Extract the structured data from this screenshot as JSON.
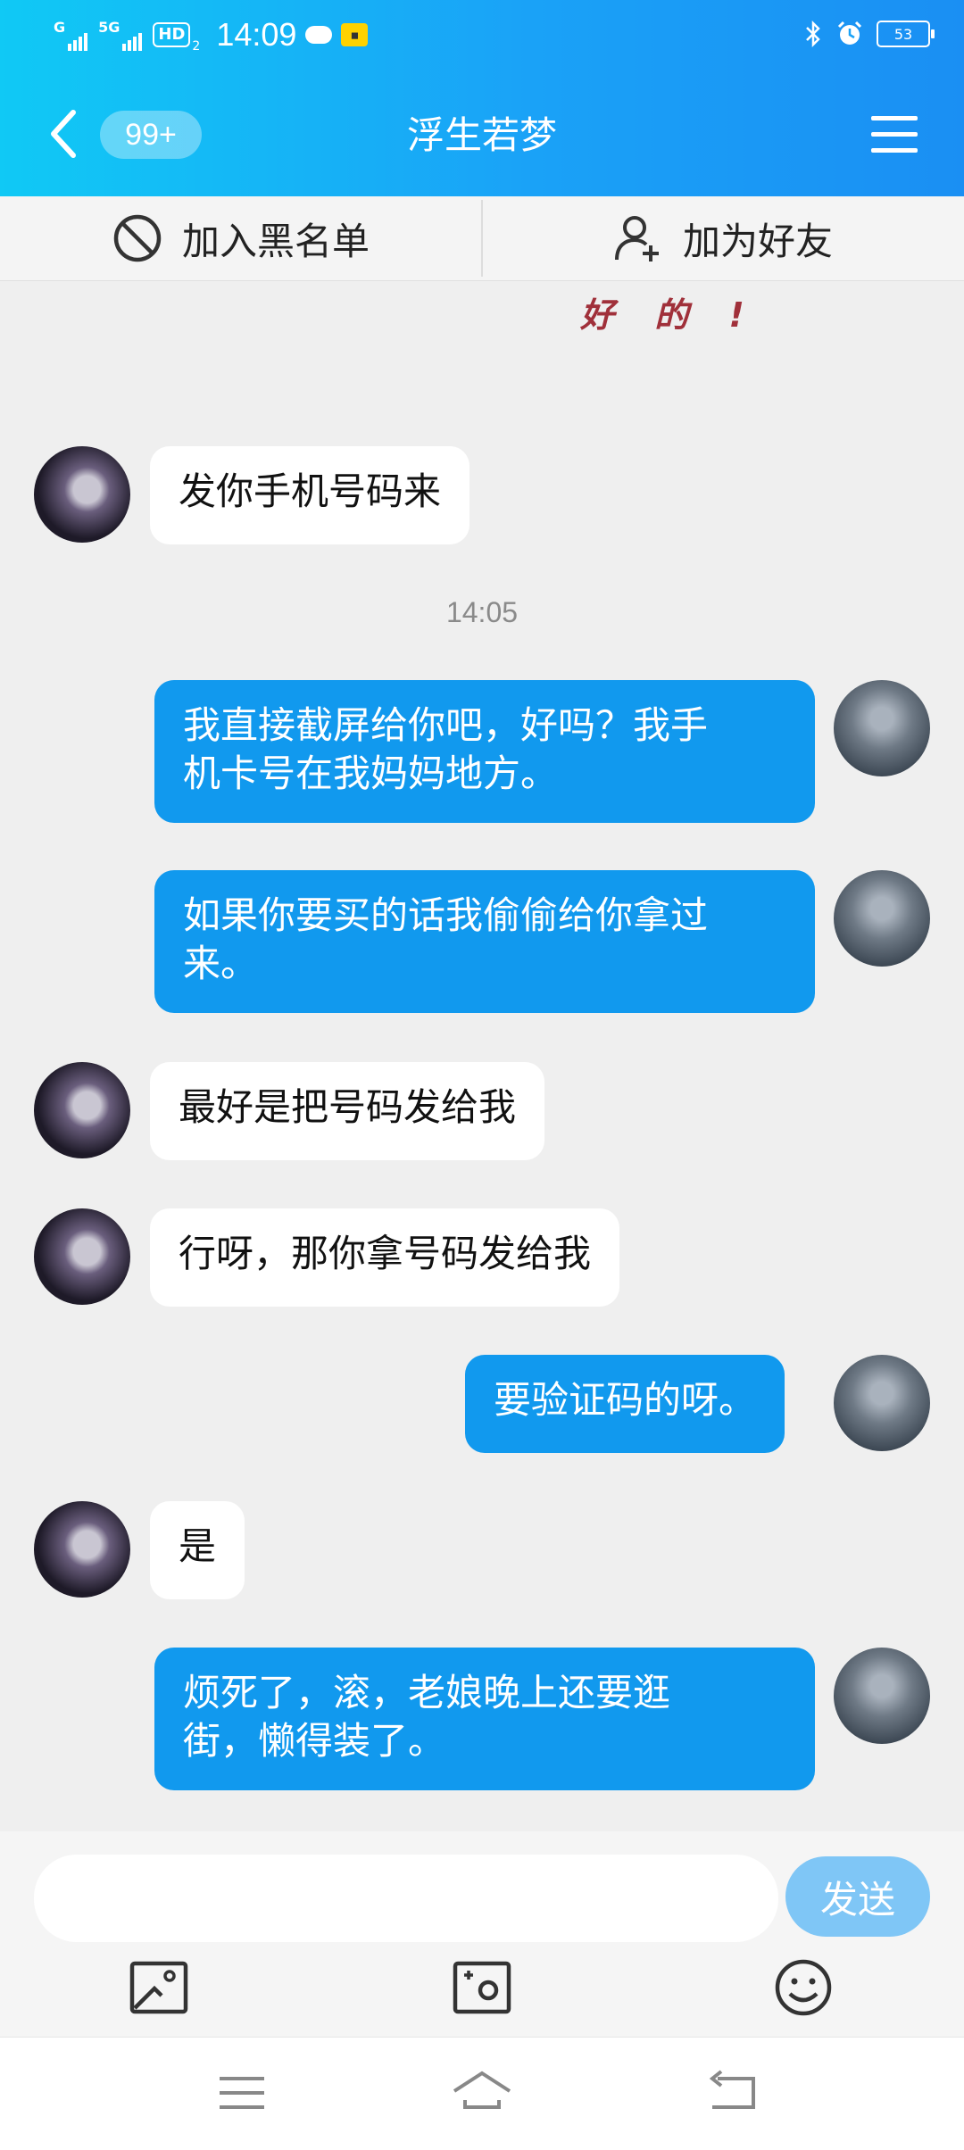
{
  "status_bar": {
    "signal1": "G",
    "signal2": "5G",
    "hd": "HD",
    "hd_sub": "2",
    "time": "14:09",
    "battery": "53"
  },
  "header": {
    "unread_badge": "99+",
    "title": "浮生若梦",
    "icons": [
      "back-arrow-icon",
      "menu-icon"
    ]
  },
  "actions": {
    "blacklist_label": "加入黑名单",
    "add_friend_label": "加为好友"
  },
  "chat": {
    "sticker_text": "好 的 !",
    "timestamp": "14:05",
    "messages": [
      {
        "side": "in",
        "text": "发你手机号码来"
      },
      {
        "side": "out",
        "text": "我直接截屏给你吧，好吗？我手\n机卡号在我妈妈地方。"
      },
      {
        "side": "out",
        "text": "如果你要买的话我偷偷给你拿过\n来。"
      },
      {
        "side": "in",
        "text": "最好是把号码发给我"
      },
      {
        "side": "in",
        "text": "行呀，那你拿号码发给我"
      },
      {
        "side": "out",
        "text": "要验证码的呀。"
      },
      {
        "side": "in",
        "text": "是"
      },
      {
        "side": "out",
        "text": "烦死了，滚，老娘晚上还要逛\n街，懒得装了。"
      }
    ]
  },
  "input": {
    "value": "",
    "send_label": "发送"
  },
  "colors": {
    "header_start": "#10c9f5",
    "header_end": "#1a8ff3",
    "outgoing_bubble": "#1199ee",
    "send_button": "#7fc6f6"
  }
}
